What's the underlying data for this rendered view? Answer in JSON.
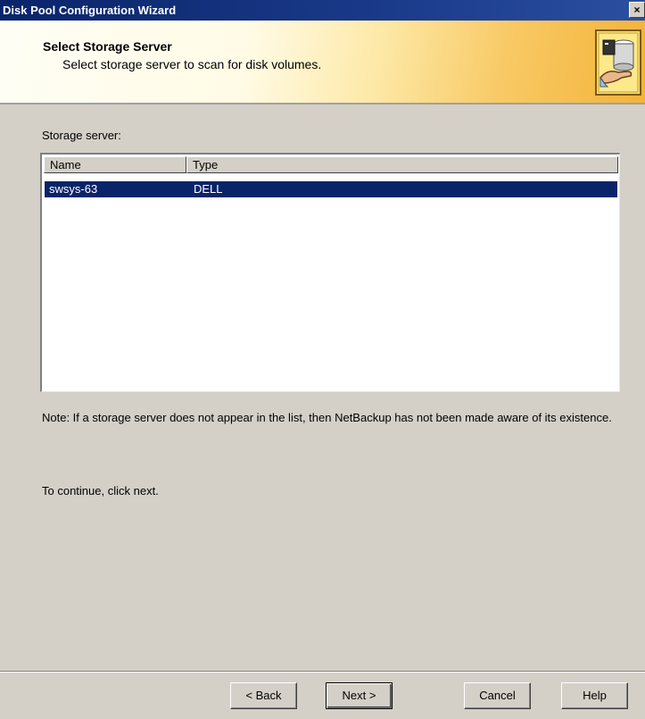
{
  "window": {
    "title": "Disk Pool Configuration Wizard",
    "close_glyph": "×"
  },
  "header": {
    "title": "Select Storage Server",
    "subtitle": "Select storage server to scan for disk volumes.",
    "icon": "storage-server-hand-icon"
  },
  "main": {
    "list_label": "Storage server:",
    "columns": [
      "Name",
      "Type"
    ],
    "rows": [
      {
        "name": "swsys-63",
        "type": "DELL",
        "selected": true
      }
    ],
    "note": "Note: If a storage server does not appear in the list, then NetBackup has not been made aware of its existence.",
    "continue_text": "To continue, click next."
  },
  "buttons": {
    "back": "< Back",
    "next": "Next >",
    "cancel": "Cancel",
    "help": "Help"
  },
  "colors": {
    "title_bar": "#0a246a",
    "selection": "#0a246a",
    "dialog": "#d4d0c8",
    "header_accent": "#f3b338"
  }
}
